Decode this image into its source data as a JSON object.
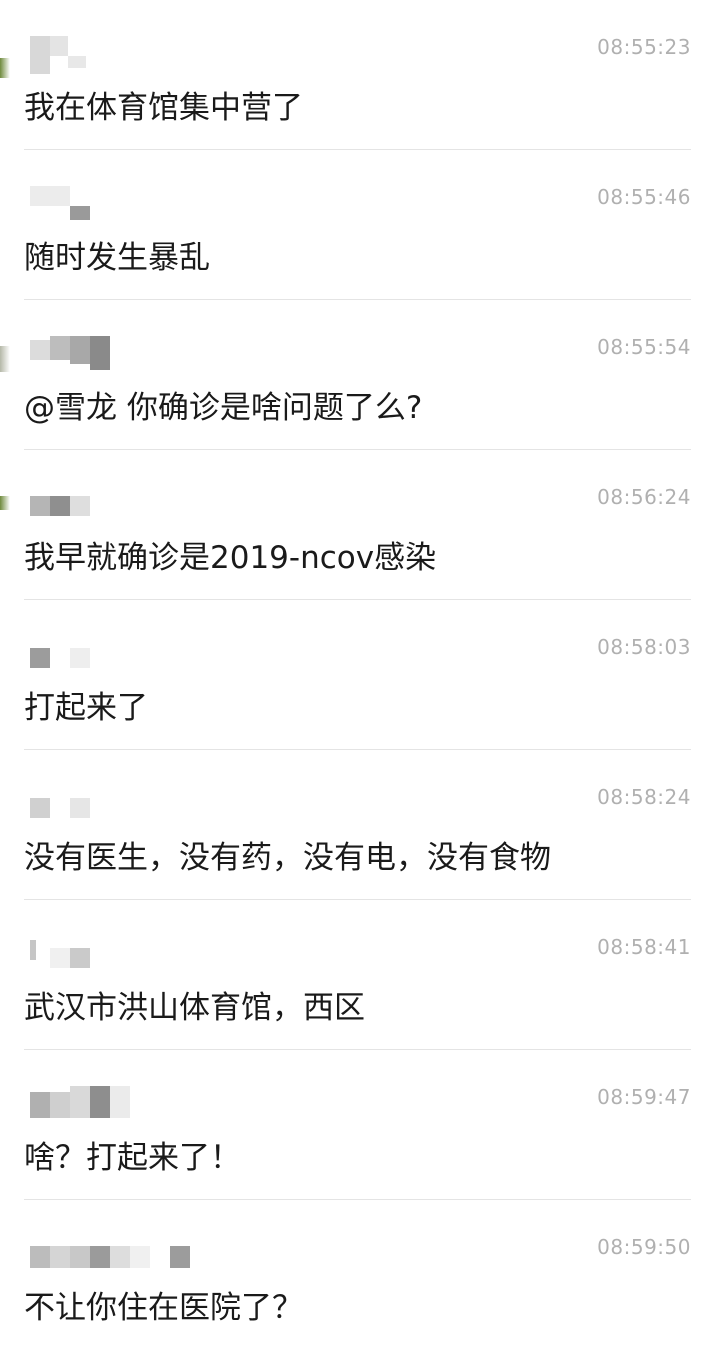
{
  "messages": [
    {
      "time": "08:55:23",
      "text": "我在体育馆集中营了"
    },
    {
      "time": "08:55:46",
      "text": "随时发生暴乱"
    },
    {
      "time": "08:55:54",
      "text": "@雪龙 你确诊是啥问题了么?"
    },
    {
      "time": "08:56:24",
      "text": "我早就确诊是2019-ncov感染"
    },
    {
      "time": "08:58:03",
      "text": "打起来了"
    },
    {
      "time": "08:58:24",
      "text": "没有医生，没有药，没有电，没有食物"
    },
    {
      "time": "08:58:41",
      "text": "武汉市洪山体育馆，西区"
    },
    {
      "time": "08:59:47",
      "text": "啥？打起来了！"
    },
    {
      "time": "08:59:50",
      "text": "不让你住在医院了？"
    }
  ]
}
